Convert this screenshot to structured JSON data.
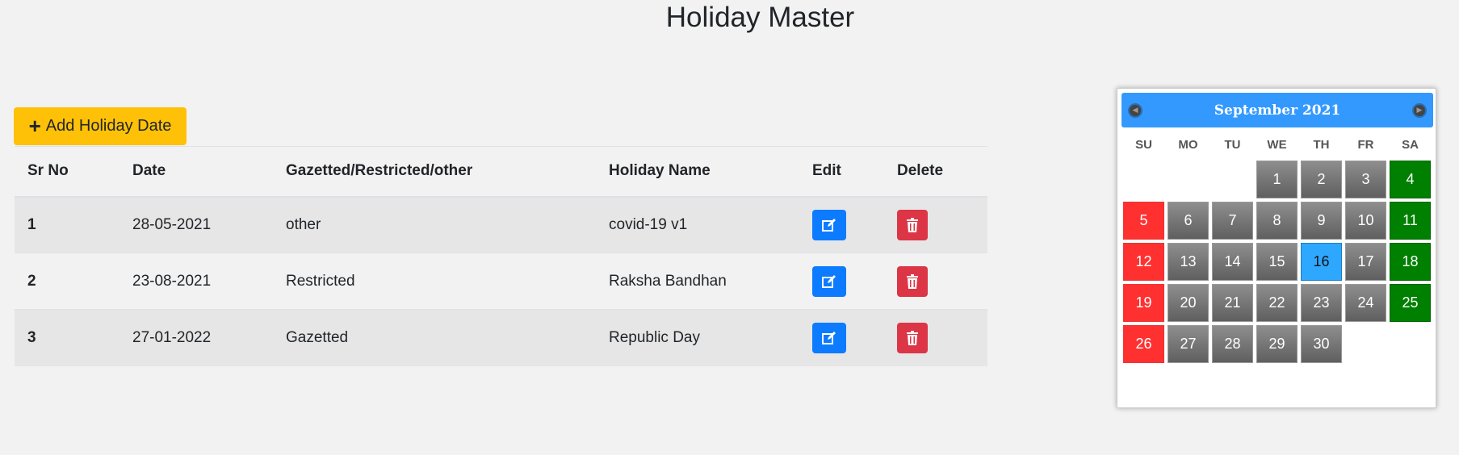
{
  "page": {
    "title": "Holiday Master"
  },
  "toolbar": {
    "add_label": "Add Holiday Date"
  },
  "table": {
    "headers": [
      "Sr No",
      "Date",
      "Gazetted/Restricted/other",
      "Holiday Name",
      "Edit",
      "Delete"
    ],
    "rows": [
      {
        "sr": "1",
        "date": "28-05-2021",
        "type": "other",
        "name": "covid-19 v1"
      },
      {
        "sr": "2",
        "date": "23-08-2021",
        "type": "Restricted",
        "name": "Raksha Bandhan"
      },
      {
        "sr": "3",
        "date": "27-01-2022",
        "type": "Gazetted",
        "name": "Republic Day"
      }
    ]
  },
  "calendar": {
    "title": "September 2021",
    "weekdays": [
      "SU",
      "MO",
      "TU",
      "WE",
      "TH",
      "FR",
      "SA"
    ],
    "first_weekday_index": 3,
    "days_in_month": 30,
    "today": 16,
    "red_days": [
      5,
      12,
      19,
      26
    ],
    "green_days": [
      4,
      11,
      18,
      25
    ]
  },
  "colors": {
    "add_button": "#ffc107",
    "edit_button": "#0d7bff",
    "delete_button": "#dc3545",
    "calendar_header": "#3399ff",
    "sunday": "#ff3030",
    "saturday": "#008000",
    "today": "#2ea8ff"
  }
}
